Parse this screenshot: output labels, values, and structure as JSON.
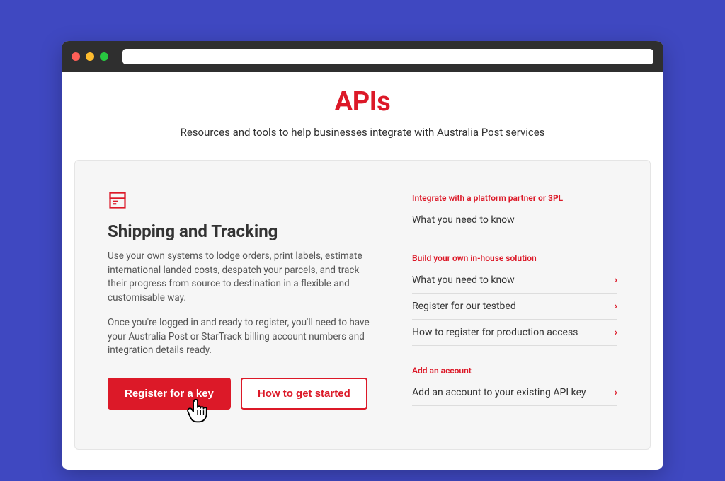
{
  "page": {
    "title": "APIs",
    "subtitle": "Resources and tools to help businesses integrate with Australia Post services"
  },
  "card": {
    "heading": "Shipping and Tracking",
    "para1": "Use your own systems to lodge orders, print labels, estimate international landed costs, despatch your parcels, and track their progress from source to destination in a flexible and customisable way.",
    "para2": "Once you're logged in and ready to register, you'll need to have your Australia Post or StarTrack billing account numbers and integration details ready.",
    "primary_btn": "Register for a key",
    "secondary_btn": "How to get started"
  },
  "groups": {
    "g1_label": "Integrate with a platform partner or 3PL",
    "g1_link1": "What you need to know",
    "g2_label": "Build your own in-house solution",
    "g2_link1": "What you need to know",
    "g2_link2": "Register for our testbed",
    "g2_link3": "How to register for production access",
    "g3_label": "Add an account",
    "g3_link1": "Add an account to your existing API key"
  }
}
